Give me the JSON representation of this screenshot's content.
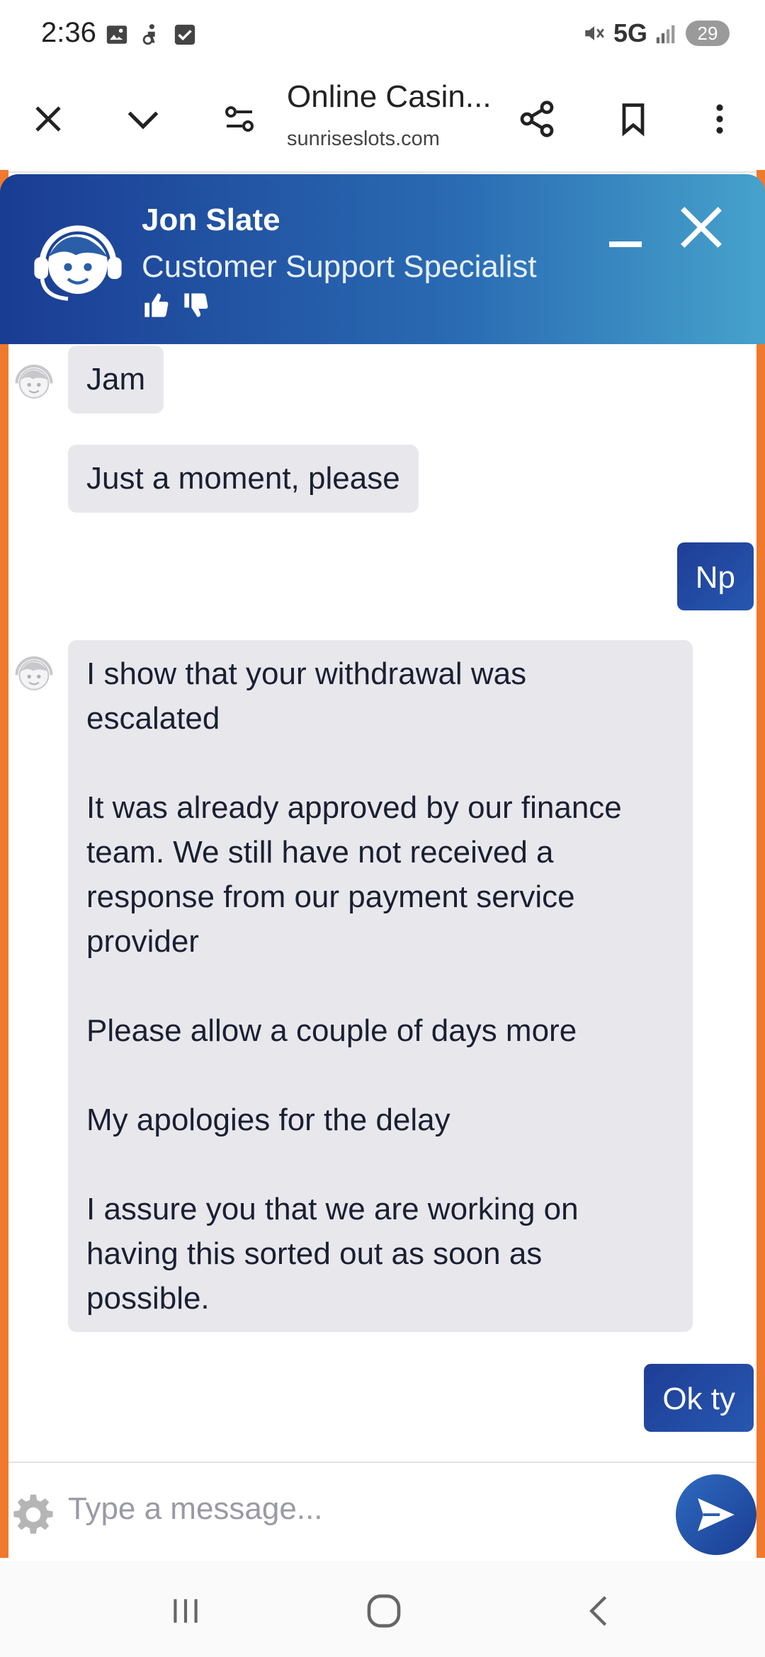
{
  "status_bar": {
    "time": "2:36",
    "network": "5G",
    "battery": "29",
    "left_icons": [
      "image-icon",
      "accessibility-icon",
      "checkbox-icon"
    ],
    "right_icons": [
      "mute-icon",
      "signal-icon",
      "battery-icon"
    ]
  },
  "browser": {
    "title": "Online Casin...",
    "url": "sunriseslots.com",
    "buttons": [
      "close-icon",
      "chevron-down-icon",
      "page-settings-icon",
      "share-icon",
      "bookmark-icon",
      "more-icon"
    ]
  },
  "chat_header": {
    "agent_name": "Jon Slate",
    "agent_role": "Customer Support Specialist",
    "colors": {
      "gradient_start": "#1a3c93",
      "gradient_end": "#46a2cc",
      "accent_edge": "#f0792e"
    }
  },
  "messages": [
    {
      "from": "agent",
      "text": "Jam"
    },
    {
      "from": "agent",
      "text": "Just a moment, please"
    },
    {
      "from": "user",
      "text": "Np"
    },
    {
      "from": "agent",
      "text": "I show that your withdrawal was\nescalated\n\nIt was already approved by our finance\nteam. We still have not received a\nresponse from our payment service\nprovider\n\nPlease allow a couple of days more\n\nMy apologies for the delay\n\nI assure you that we are working on\nhaving this sorted out as soon as\npossible."
    },
    {
      "from": "user",
      "text": "Ok ty"
    }
  ],
  "composer": {
    "placeholder": "Type a message..."
  }
}
